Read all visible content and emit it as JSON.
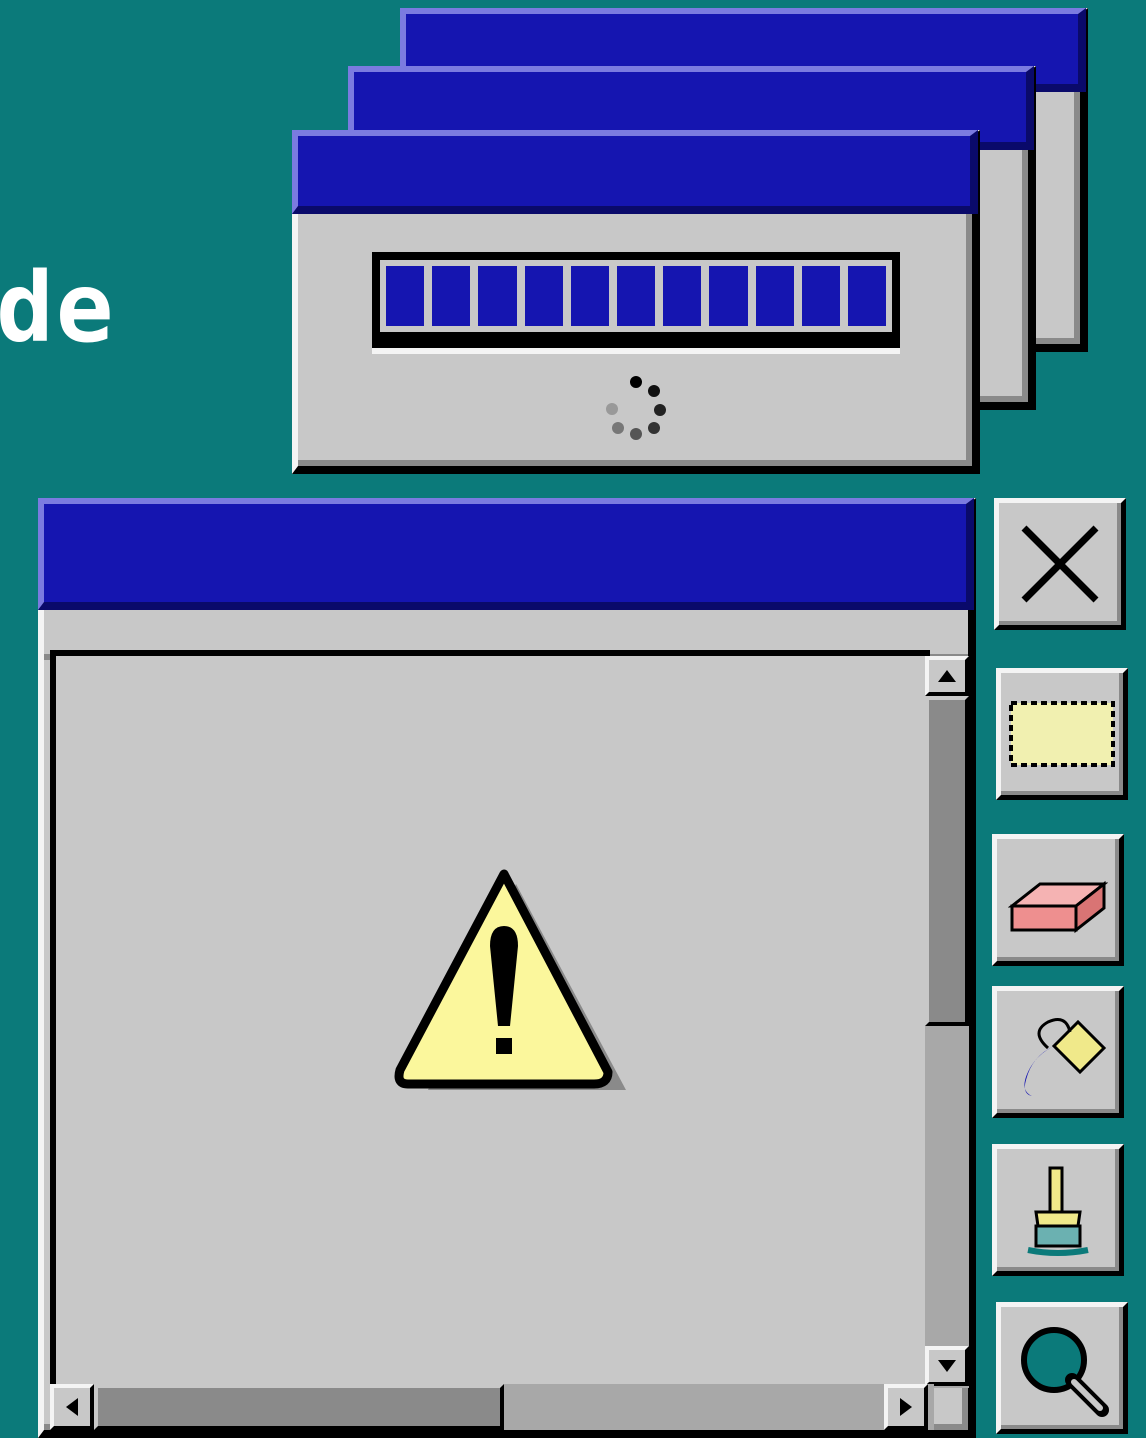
{
  "desktop": {
    "partial_title": "de"
  },
  "progress_dialog": {
    "progress_percent": 100,
    "segments": 11
  },
  "alert_window": {
    "icon": "warning-icon"
  },
  "toolbar": {
    "tools": [
      {
        "name": "close-icon"
      },
      {
        "name": "select-rectangle-icon"
      },
      {
        "name": "eraser-icon"
      },
      {
        "name": "paint-bucket-icon"
      },
      {
        "name": "paintbrush-icon"
      },
      {
        "name": "magnifier-icon"
      }
    ]
  },
  "colors": {
    "desktop": "#0b7a7a",
    "titlebar": "#1515b0",
    "window_face": "#c8c8c8",
    "warning_fill": "#fbf79c"
  }
}
